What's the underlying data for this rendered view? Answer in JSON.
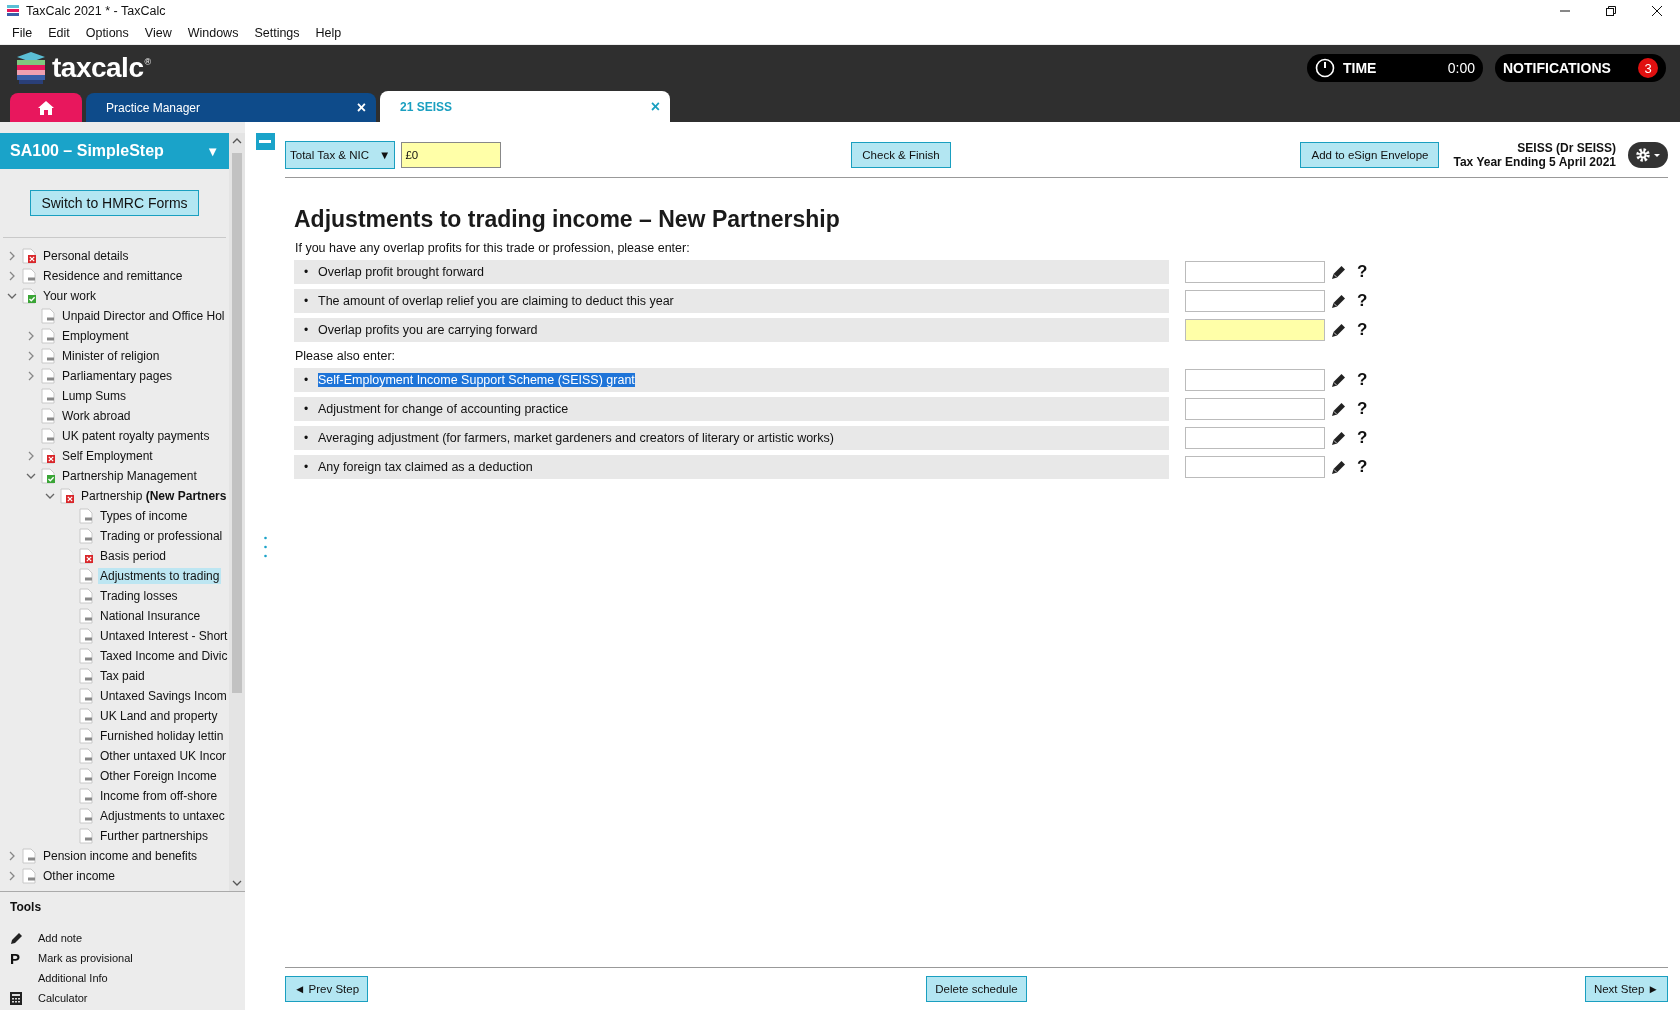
{
  "window": {
    "title": "TaxCalc 2021 * - TaxCalc"
  },
  "menu": [
    "File",
    "Edit",
    "Options",
    "View",
    "Windows",
    "Settings",
    "Help"
  ],
  "header": {
    "logo": {
      "text": "taxcalc",
      "mark": "®"
    },
    "time": {
      "label": "TIME",
      "value": "0:00"
    },
    "notifications": {
      "label": "NOTIFICATIONS",
      "count": "3"
    }
  },
  "tabs": [
    {
      "kind": "home",
      "selected": false
    },
    {
      "kind": "doc",
      "label": "Practice Manager",
      "close": "×",
      "selected": false
    },
    {
      "kind": "doc",
      "label": "21 SEISS",
      "close": "×",
      "selected": true
    }
  ],
  "sidebar": {
    "title": "SA100 – SimpleStep",
    "title_caret": "▼",
    "switch_button": "Switch to HMRC Forms",
    "tree": [
      {
        "label": "Personal details",
        "kind": "error",
        "expanded": false,
        "selected": false
      },
      {
        "label": "Residence and remittance",
        "kind": "plain",
        "expanded": false,
        "selected": false
      },
      {
        "label": "Your work",
        "kind": "complete",
        "expanded": true,
        "selected": false,
        "children": [
          {
            "label": "Unpaid Director and Office Hol",
            "kind": "plain",
            "selected": false
          },
          {
            "label": "Employment",
            "kind": "plain",
            "expanded": false,
            "selected": false
          },
          {
            "label": "Minister of religion",
            "kind": "plain",
            "expanded": false,
            "selected": false
          },
          {
            "label": "Parliamentary pages",
            "kind": "plain",
            "expanded": false,
            "selected": false
          },
          {
            "label": "Lump Sums",
            "kind": "plain",
            "selected": false
          },
          {
            "label": "Work abroad",
            "kind": "plain",
            "selected": false
          },
          {
            "label": "UK patent royalty payments",
            "kind": "plain",
            "selected": false
          },
          {
            "label": "Self Employment",
            "kind": "error",
            "expanded": false,
            "selected": false
          },
          {
            "label": "Partnership Management",
            "kind": "complete",
            "expanded": true,
            "selected": false,
            "children": [
              {
                "label": "Partnership **(New Partners**",
                "kind": "error",
                "expanded": true,
                "selected": false,
                "children": [
                  {
                    "label": "Types of income",
                    "kind": "plain",
                    "selected": false
                  },
                  {
                    "label": "Trading or professional",
                    "kind": "plain",
                    "selected": false
                  },
                  {
                    "label": "Basis period",
                    "kind": "error",
                    "selected": false
                  },
                  {
                    "label": "Adjustments to trading",
                    "kind": "plain",
                    "selected": true
                  },
                  {
                    "label": "Trading losses",
                    "kind": "plain",
                    "selected": false
                  },
                  {
                    "label": "National Insurance",
                    "kind": "plain",
                    "selected": false
                  },
                  {
                    "label": "Untaxed Interest - Short",
                    "kind": "plain",
                    "selected": false
                  },
                  {
                    "label": "Taxed Income and Divic",
                    "kind": "plain",
                    "selected": false
                  },
                  {
                    "label": "Tax paid",
                    "kind": "plain",
                    "selected": false
                  },
                  {
                    "label": "Untaxed Savings Incom",
                    "kind": "plain",
                    "selected": false
                  },
                  {
                    "label": "UK Land and property",
                    "kind": "plain",
                    "selected": false
                  },
                  {
                    "label": "Furnished holiday lettin",
                    "kind": "plain",
                    "selected": false
                  },
                  {
                    "label": "Other untaxed UK Incor",
                    "kind": "plain",
                    "selected": false
                  },
                  {
                    "label": "Other Foreign Income",
                    "kind": "plain",
                    "selected": false
                  },
                  {
                    "label": "Income from off-shore",
                    "kind": "plain",
                    "selected": false
                  },
                  {
                    "label": "Adjustments to untaxec",
                    "kind": "plain",
                    "selected": false
                  },
                  {
                    "label": "Further partnerships",
                    "kind": "plain",
                    "selected": false
                  }
                ]
              }
            ]
          }
        ]
      },
      {
        "label": "Pension income and benefits",
        "kind": "plain",
        "expanded": false,
        "selected": false
      },
      {
        "label": "Other income",
        "kind": "plain",
        "expanded": false,
        "selected": false
      }
    ],
    "tools_title": "Tools",
    "tools": [
      {
        "kind": "pencil",
        "label": "Add note"
      },
      {
        "kind": "letter",
        "icon_text": "P",
        "label": "Mark as provisional"
      },
      {
        "kind": "plain",
        "label": "Additional Info"
      },
      {
        "kind": "calculator",
        "label": "Calculator"
      }
    ]
  },
  "toolbar": {
    "summary_select": "Total Tax & NIC",
    "summary_caret": "▼",
    "summary_value": "£0",
    "check_button": "Check & Finish",
    "esign_button": "Add to eSign Envelope",
    "client": "SEISS (Dr SEISS)",
    "tax_year": "Tax Year Ending 5 April 2021"
  },
  "form": {
    "title": "Adjustments to trading income – New Partnership",
    "sections": [
      {
        "intro": "If you have any overlap profits for this trade or profession, please enter:",
        "rows": [
          {
            "bullet": "•",
            "label": "Overlap profit brought forward",
            "highlighted": false,
            "selected": false,
            "help": "?"
          },
          {
            "bullet": "•",
            "label": "The amount of overlap relief you are claiming to deduct this year",
            "highlighted": false,
            "selected": false,
            "help": "?"
          },
          {
            "bullet": "•",
            "label": "Overlap profits you are carrying forward",
            "highlighted": true,
            "selected": false,
            "help": "?"
          }
        ]
      },
      {
        "intro": "Please also enter:",
        "rows": [
          {
            "bullet": "•",
            "label": "Self-Employment Income Support Scheme (SEISS) grant",
            "highlighted": false,
            "selected": true,
            "help": "?"
          },
          {
            "bullet": "•",
            "label": "Adjustment for change of accounting practice",
            "highlighted": false,
            "selected": false,
            "help": "?"
          },
          {
            "bullet": "•",
            "label": "Averaging adjustment (for farmers, market gardeners and creators of literary or artistic works)",
            "highlighted": false,
            "selected": false,
            "help": "?"
          },
          {
            "bullet": "•",
            "label": "Any foreign tax claimed as a deduction",
            "highlighted": false,
            "selected": false,
            "help": "?"
          }
        ]
      }
    ]
  },
  "footer": {
    "prev": "◄ Prev Step",
    "delete": "Delete schedule",
    "next": "Next Step ►"
  }
}
